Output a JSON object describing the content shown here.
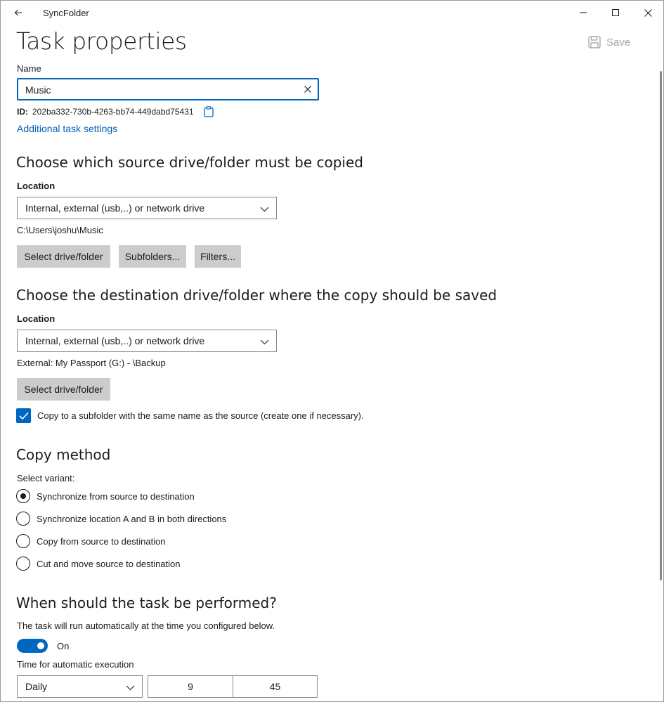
{
  "app": {
    "title": "SyncFolder"
  },
  "page": {
    "title": "Task properties",
    "save_label": "Save"
  },
  "name": {
    "label": "Name",
    "value": "Music"
  },
  "id": {
    "label": "ID:",
    "value": "202ba332-730b-4263-bb74-449dabd75431"
  },
  "additional_settings_link": "Additional task settings",
  "source": {
    "heading": "Choose which source drive/folder must be copied",
    "location_label": "Location",
    "location_value": "Internal, external (usb,..) or network drive",
    "path": "C:\\Users\\joshu\\Music",
    "buttons": {
      "select": "Select drive/folder",
      "subfolders": "Subfolders...",
      "filters": "Filters..."
    }
  },
  "destination": {
    "heading": "Choose the destination drive/folder where the copy should be saved",
    "location_label": "Location",
    "location_value": "Internal, external (usb,..) or network drive",
    "path": "External: My Passport (G:) - \\Backup",
    "select_button": "Select drive/folder",
    "subfolder_checkbox": {
      "label": "Copy to a subfolder with the same name as the source (create one if necessary).",
      "checked": true
    }
  },
  "copy_method": {
    "heading": "Copy method",
    "variant_label": "Select variant:",
    "options": [
      {
        "label": "Synchronize from source to destination",
        "selected": true
      },
      {
        "label": "Synchronize location A and B in both directions",
        "selected": false
      },
      {
        "label": "Copy from source to destination",
        "selected": false
      },
      {
        "label": "Cut and move source to destination",
        "selected": false
      }
    ]
  },
  "schedule": {
    "heading": "When should the task be performed?",
    "description": "The task will run automatically at the time you configured below.",
    "toggle_label": "On",
    "toggle_on": true,
    "time_label": "Time for automatic execution",
    "frequency": "Daily",
    "hour": "9",
    "minute": "45"
  },
  "colors": {
    "accent": "#0067c0",
    "link": "#005fb8",
    "button": "#cccccc"
  }
}
